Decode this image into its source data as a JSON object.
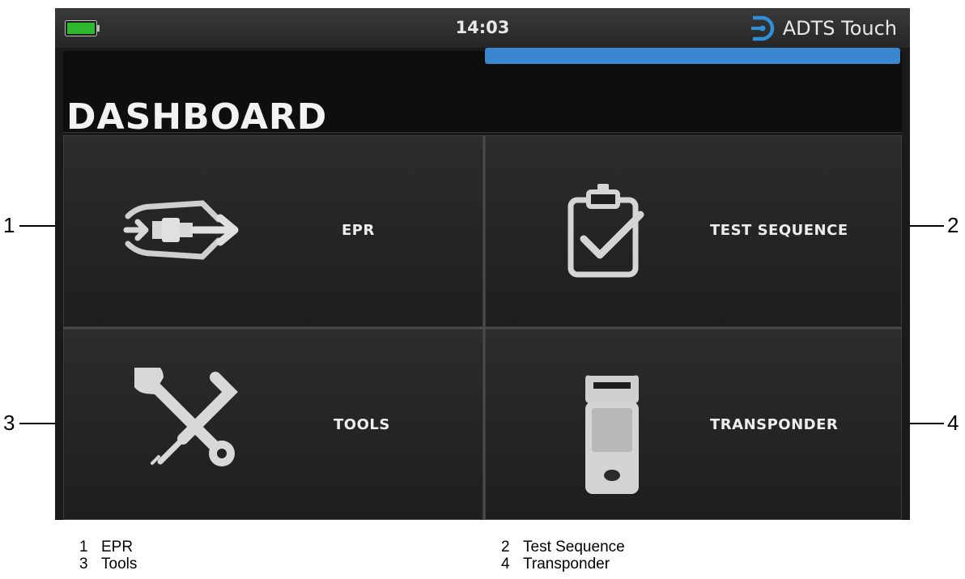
{
  "status_bar": {
    "time": "14:03",
    "brand": "ADTS Touch",
    "battery_color": "#2eb82e"
  },
  "progress": {
    "fill_fraction": 1.0,
    "color": "#3a87cf"
  },
  "page_title": "DASHBOARD",
  "tiles": [
    {
      "label": "EPR",
      "icon": "epr-icon"
    },
    {
      "label": "TEST SEQUENCE",
      "icon": "clipboard-check-icon"
    },
    {
      "label": "TOOLS",
      "icon": "wrench-screwdriver-icon"
    },
    {
      "label": "TRANSPONDER",
      "icon": "transponder-device-icon"
    }
  ],
  "callouts": [
    "1",
    "2",
    "3",
    "4"
  ],
  "legend": [
    {
      "num": "1",
      "label": "EPR"
    },
    {
      "num": "2",
      "label": "Test Sequence"
    },
    {
      "num": "3",
      "label": "Tools"
    },
    {
      "num": "4",
      "label": "Transponder"
    }
  ]
}
